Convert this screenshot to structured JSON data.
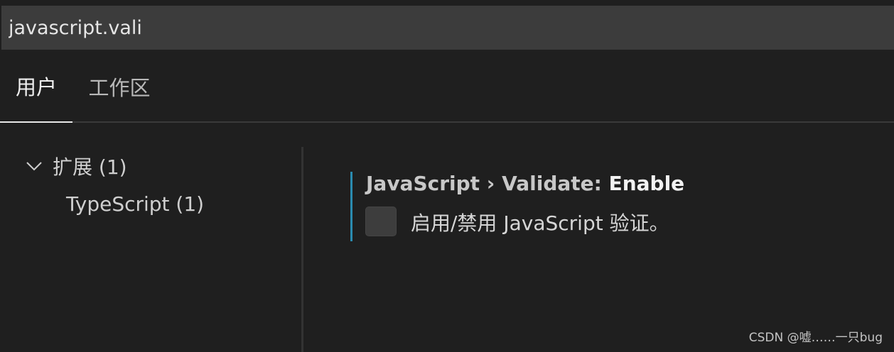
{
  "search": {
    "value": "javascript.vali"
  },
  "tabs": [
    {
      "label": "用户",
      "active": true
    },
    {
      "label": "工作区",
      "active": false
    }
  ],
  "toc": {
    "items": [
      {
        "label": "扩展 (1)",
        "expanded": true,
        "icon": "chevron-down-icon"
      },
      {
        "label": "TypeScript (1)"
      }
    ]
  },
  "setting": {
    "category": "JavaScript › Validate: ",
    "key": "Enable",
    "description": "启用/禁用 JavaScript 验证。",
    "checked": false,
    "accent_color": "#2a8bb0"
  },
  "watermark": "CSDN @嘘……一只bug"
}
